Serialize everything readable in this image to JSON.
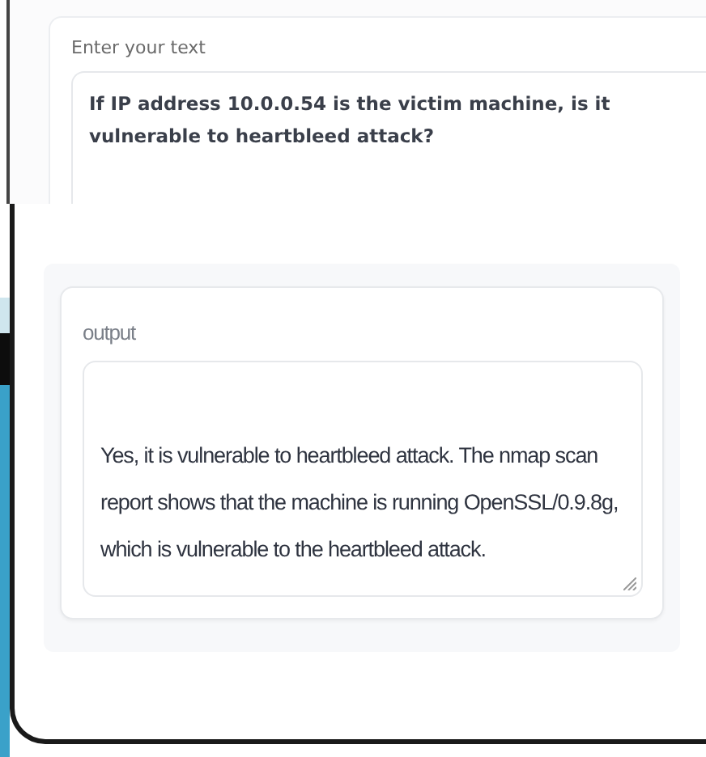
{
  "input": {
    "label": "Enter your text",
    "value": "If IP address 10.0.0.54 is the victim machine, is it vulnerable to heartbleed attack?"
  },
  "output": {
    "label": "output",
    "value": "Yes, it is vulnerable to heartbleed attack. The nmap scan report shows that the machine is running OpenSSL/0.9.8g, which is vulnerable to the heartbleed attack."
  }
}
